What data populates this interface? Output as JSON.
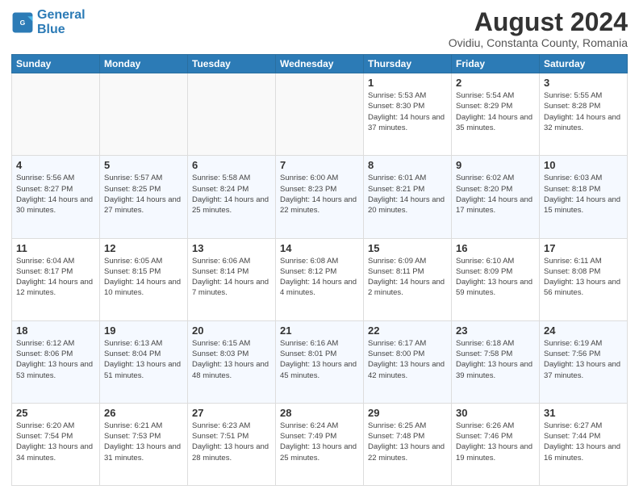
{
  "logo": {
    "text1": "General",
    "text2": "Blue"
  },
  "title": "August 2024",
  "subtitle": "Ovidiu, Constanta County, Romania",
  "days_of_week": [
    "Sunday",
    "Monday",
    "Tuesday",
    "Wednesday",
    "Thursday",
    "Friday",
    "Saturday"
  ],
  "weeks": [
    [
      {
        "day": "",
        "info": ""
      },
      {
        "day": "",
        "info": ""
      },
      {
        "day": "",
        "info": ""
      },
      {
        "day": "",
        "info": ""
      },
      {
        "day": "1",
        "info": "Sunrise: 5:53 AM\nSunset: 8:30 PM\nDaylight: 14 hours\nand 37 minutes."
      },
      {
        "day": "2",
        "info": "Sunrise: 5:54 AM\nSunset: 8:29 PM\nDaylight: 14 hours\nand 35 minutes."
      },
      {
        "day": "3",
        "info": "Sunrise: 5:55 AM\nSunset: 8:28 PM\nDaylight: 14 hours\nand 32 minutes."
      }
    ],
    [
      {
        "day": "4",
        "info": "Sunrise: 5:56 AM\nSunset: 8:27 PM\nDaylight: 14 hours\nand 30 minutes."
      },
      {
        "day": "5",
        "info": "Sunrise: 5:57 AM\nSunset: 8:25 PM\nDaylight: 14 hours\nand 27 minutes."
      },
      {
        "day": "6",
        "info": "Sunrise: 5:58 AM\nSunset: 8:24 PM\nDaylight: 14 hours\nand 25 minutes."
      },
      {
        "day": "7",
        "info": "Sunrise: 6:00 AM\nSunset: 8:23 PM\nDaylight: 14 hours\nand 22 minutes."
      },
      {
        "day": "8",
        "info": "Sunrise: 6:01 AM\nSunset: 8:21 PM\nDaylight: 14 hours\nand 20 minutes."
      },
      {
        "day": "9",
        "info": "Sunrise: 6:02 AM\nSunset: 8:20 PM\nDaylight: 14 hours\nand 17 minutes."
      },
      {
        "day": "10",
        "info": "Sunrise: 6:03 AM\nSunset: 8:18 PM\nDaylight: 14 hours\nand 15 minutes."
      }
    ],
    [
      {
        "day": "11",
        "info": "Sunrise: 6:04 AM\nSunset: 8:17 PM\nDaylight: 14 hours\nand 12 minutes."
      },
      {
        "day": "12",
        "info": "Sunrise: 6:05 AM\nSunset: 8:15 PM\nDaylight: 14 hours\nand 10 minutes."
      },
      {
        "day": "13",
        "info": "Sunrise: 6:06 AM\nSunset: 8:14 PM\nDaylight: 14 hours\nand 7 minutes."
      },
      {
        "day": "14",
        "info": "Sunrise: 6:08 AM\nSunset: 8:12 PM\nDaylight: 14 hours\nand 4 minutes."
      },
      {
        "day": "15",
        "info": "Sunrise: 6:09 AM\nSunset: 8:11 PM\nDaylight: 14 hours\nand 2 minutes."
      },
      {
        "day": "16",
        "info": "Sunrise: 6:10 AM\nSunset: 8:09 PM\nDaylight: 13 hours\nand 59 minutes."
      },
      {
        "day": "17",
        "info": "Sunrise: 6:11 AM\nSunset: 8:08 PM\nDaylight: 13 hours\nand 56 minutes."
      }
    ],
    [
      {
        "day": "18",
        "info": "Sunrise: 6:12 AM\nSunset: 8:06 PM\nDaylight: 13 hours\nand 53 minutes."
      },
      {
        "day": "19",
        "info": "Sunrise: 6:13 AM\nSunset: 8:04 PM\nDaylight: 13 hours\nand 51 minutes."
      },
      {
        "day": "20",
        "info": "Sunrise: 6:15 AM\nSunset: 8:03 PM\nDaylight: 13 hours\nand 48 minutes."
      },
      {
        "day": "21",
        "info": "Sunrise: 6:16 AM\nSunset: 8:01 PM\nDaylight: 13 hours\nand 45 minutes."
      },
      {
        "day": "22",
        "info": "Sunrise: 6:17 AM\nSunset: 8:00 PM\nDaylight: 13 hours\nand 42 minutes."
      },
      {
        "day": "23",
        "info": "Sunrise: 6:18 AM\nSunset: 7:58 PM\nDaylight: 13 hours\nand 39 minutes."
      },
      {
        "day": "24",
        "info": "Sunrise: 6:19 AM\nSunset: 7:56 PM\nDaylight: 13 hours\nand 37 minutes."
      }
    ],
    [
      {
        "day": "25",
        "info": "Sunrise: 6:20 AM\nSunset: 7:54 PM\nDaylight: 13 hours\nand 34 minutes."
      },
      {
        "day": "26",
        "info": "Sunrise: 6:21 AM\nSunset: 7:53 PM\nDaylight: 13 hours\nand 31 minutes."
      },
      {
        "day": "27",
        "info": "Sunrise: 6:23 AM\nSunset: 7:51 PM\nDaylight: 13 hours\nand 28 minutes."
      },
      {
        "day": "28",
        "info": "Sunrise: 6:24 AM\nSunset: 7:49 PM\nDaylight: 13 hours\nand 25 minutes."
      },
      {
        "day": "29",
        "info": "Sunrise: 6:25 AM\nSunset: 7:48 PM\nDaylight: 13 hours\nand 22 minutes."
      },
      {
        "day": "30",
        "info": "Sunrise: 6:26 AM\nSunset: 7:46 PM\nDaylight: 13 hours\nand 19 minutes."
      },
      {
        "day": "31",
        "info": "Sunrise: 6:27 AM\nSunset: 7:44 PM\nDaylight: 13 hours\nand 16 minutes."
      }
    ]
  ]
}
